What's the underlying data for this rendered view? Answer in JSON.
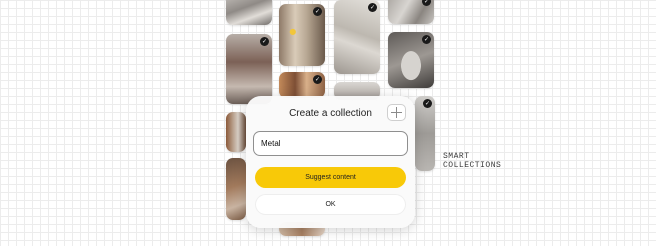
{
  "dialog": {
    "title": "Create a collection",
    "name_value": "Metal",
    "suggest_label": "Suggest content",
    "ok_label": "OK"
  },
  "side_label": {
    "line1": "SMART",
    "line2": "COLLECTIONS"
  },
  "colors": {
    "accent": "#f8c908",
    "check_badge": "#1a1a1a",
    "background_grid": "#ececec"
  },
  "icons": {
    "add_button": "plus-icon",
    "selected_badge": "checkmark-icon"
  },
  "gallery": {
    "selected_mark": "✓",
    "selected_tiles": 8
  }
}
